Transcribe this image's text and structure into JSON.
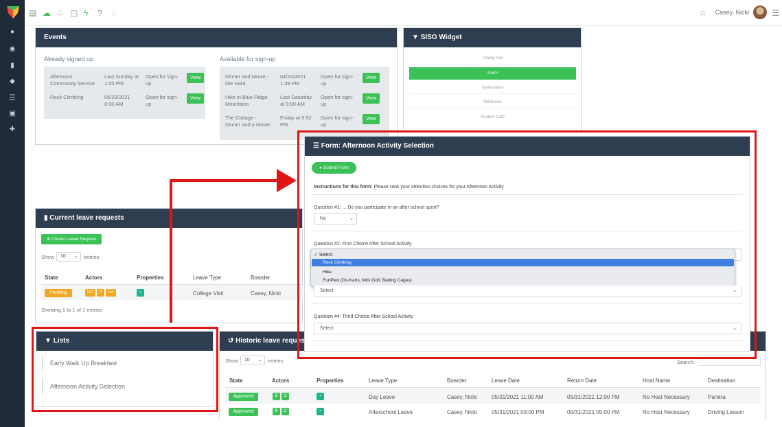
{
  "topbar": {
    "user_name": "Casey, Nicki"
  },
  "events": {
    "title": "Events",
    "signed_up_title": "Already signed up",
    "available_title": "Avaliable for sign-up",
    "signed_up": [
      {
        "name_l1": "Afternoon",
        "name_l2": "Community Service",
        "date_l1": "Last Sunday at",
        "date_l2": "1:00 PM",
        "status_l1": "Open for sign-",
        "status_l2": "up",
        "button": "View"
      },
      {
        "name_l1": "Rock Climbing",
        "name_l2": "",
        "date_l1": "06/23/2021",
        "date_l2": "8:00 AM",
        "status_l1": "Open for sign-",
        "status_l2": "up",
        "button": "View"
      }
    ],
    "available": [
      {
        "name_l1": "Dinner and Movie -",
        "name_l2": "Die Hard",
        "date_l1": "04/24/2021",
        "date_l2": "1:39 PM",
        "status_l1": "Open for sign-",
        "status_l2": "up",
        "button": "View"
      },
      {
        "name_l1": "Hike in Blue Ridge",
        "name_l2": "Mountains",
        "date_l1": "Last Saturday",
        "date_l2": "at 9:00 AM",
        "status_l1": "Open for sign-",
        "status_l2": "up",
        "button": "View"
      },
      {
        "name_l1": "The Cottage -",
        "name_l2": "Dinner and a Movie",
        "date_l1": "Friday at 6:52",
        "date_l2": "PM",
        "status_l1": "Open for sign-",
        "status_l2": "up",
        "button": "View"
      }
    ]
  },
  "siso": {
    "title": "SISO Widget",
    "locations": [
      "Dining Hall",
      "Dorm",
      "Gymnasium",
      "Starbucks",
      "Student Cafe"
    ],
    "active": "Dorm",
    "active_color": "#3cc157"
  },
  "form": {
    "title": "Form: Afternoon Activity Selection",
    "submit_label": "Submit Form",
    "instructions_label": "Instructions for this form:",
    "instructions_text": "Please rank your selection choices for your Afternoon Activity.",
    "q1": {
      "label": "Question #1: ... Do you participate in an after school sport?",
      "value": "No"
    },
    "q2": {
      "label": "Question #2: First Choice After School Activity"
    },
    "q3": {
      "value": "Select"
    },
    "q4": {
      "label": "Question #4: Third Choice After School Activity",
      "value": "Select"
    },
    "dropdown_options": [
      "Select",
      "Rock Climbing",
      "Hike",
      "FunPlex (Go-Karts, Mini Golf, Batting Cages)"
    ],
    "dropdown_checked": "Select",
    "dropdown_highlighted": "Rock Climbing"
  },
  "leave": {
    "title": "Current leave requests",
    "create_label": "Create Leave Request",
    "show_label": "Show",
    "show_value": "10",
    "entries_label": "entries",
    "columns": [
      "State",
      "Actors",
      "Properties",
      "Leave Type",
      "Boarder"
    ],
    "row": {
      "state": "Pending",
      "actors": [
        "DO",
        "P",
        "DA"
      ],
      "leave_type": "College Visit",
      "boarder": "Casey, Nicki"
    },
    "footer": "Showing 1 to 1 of 1 entries"
  },
  "lists": {
    "title": "Lists",
    "items": [
      "Early Walk Up Breakfast",
      "Afternoon Activity Selection"
    ]
  },
  "historic": {
    "title": "Historic leave request",
    "show_label": "Show",
    "show_value": "10",
    "entries_label": "entries",
    "search_label": "Search:",
    "columns": [
      "State",
      "Actors",
      "Properties",
      "Leave Type",
      "Boarder",
      "Leave Date",
      "Return Date",
      "Host Name",
      "Destination"
    ],
    "rows": [
      {
        "state": "Approved",
        "actors": [
          "B",
          "O"
        ],
        "leave_type": "Day Leave",
        "boarder": "Casey, Nicki",
        "leave_date": "05/31/2021 11:00 AM",
        "return_date": "05/31/2021 12:00 PM",
        "host": "No Host Necessary",
        "destination": "Panera"
      },
      {
        "state": "Approved",
        "actors": [
          "B",
          "O"
        ],
        "leave_type": "Afterschool Leave",
        "boarder": "Casey, Nicki",
        "leave_date": "05/31/2021 03:00 PM",
        "return_date": "05/31/2021 05:00 PM",
        "host": "No Host Necessary",
        "destination": "Driving Lesson"
      }
    ]
  },
  "colors": {
    "header": "#2e3e50",
    "green": "#3cc157",
    "pending": "#f0a821",
    "highlight": "#e01515",
    "select_blue": "#3f7fe0"
  }
}
